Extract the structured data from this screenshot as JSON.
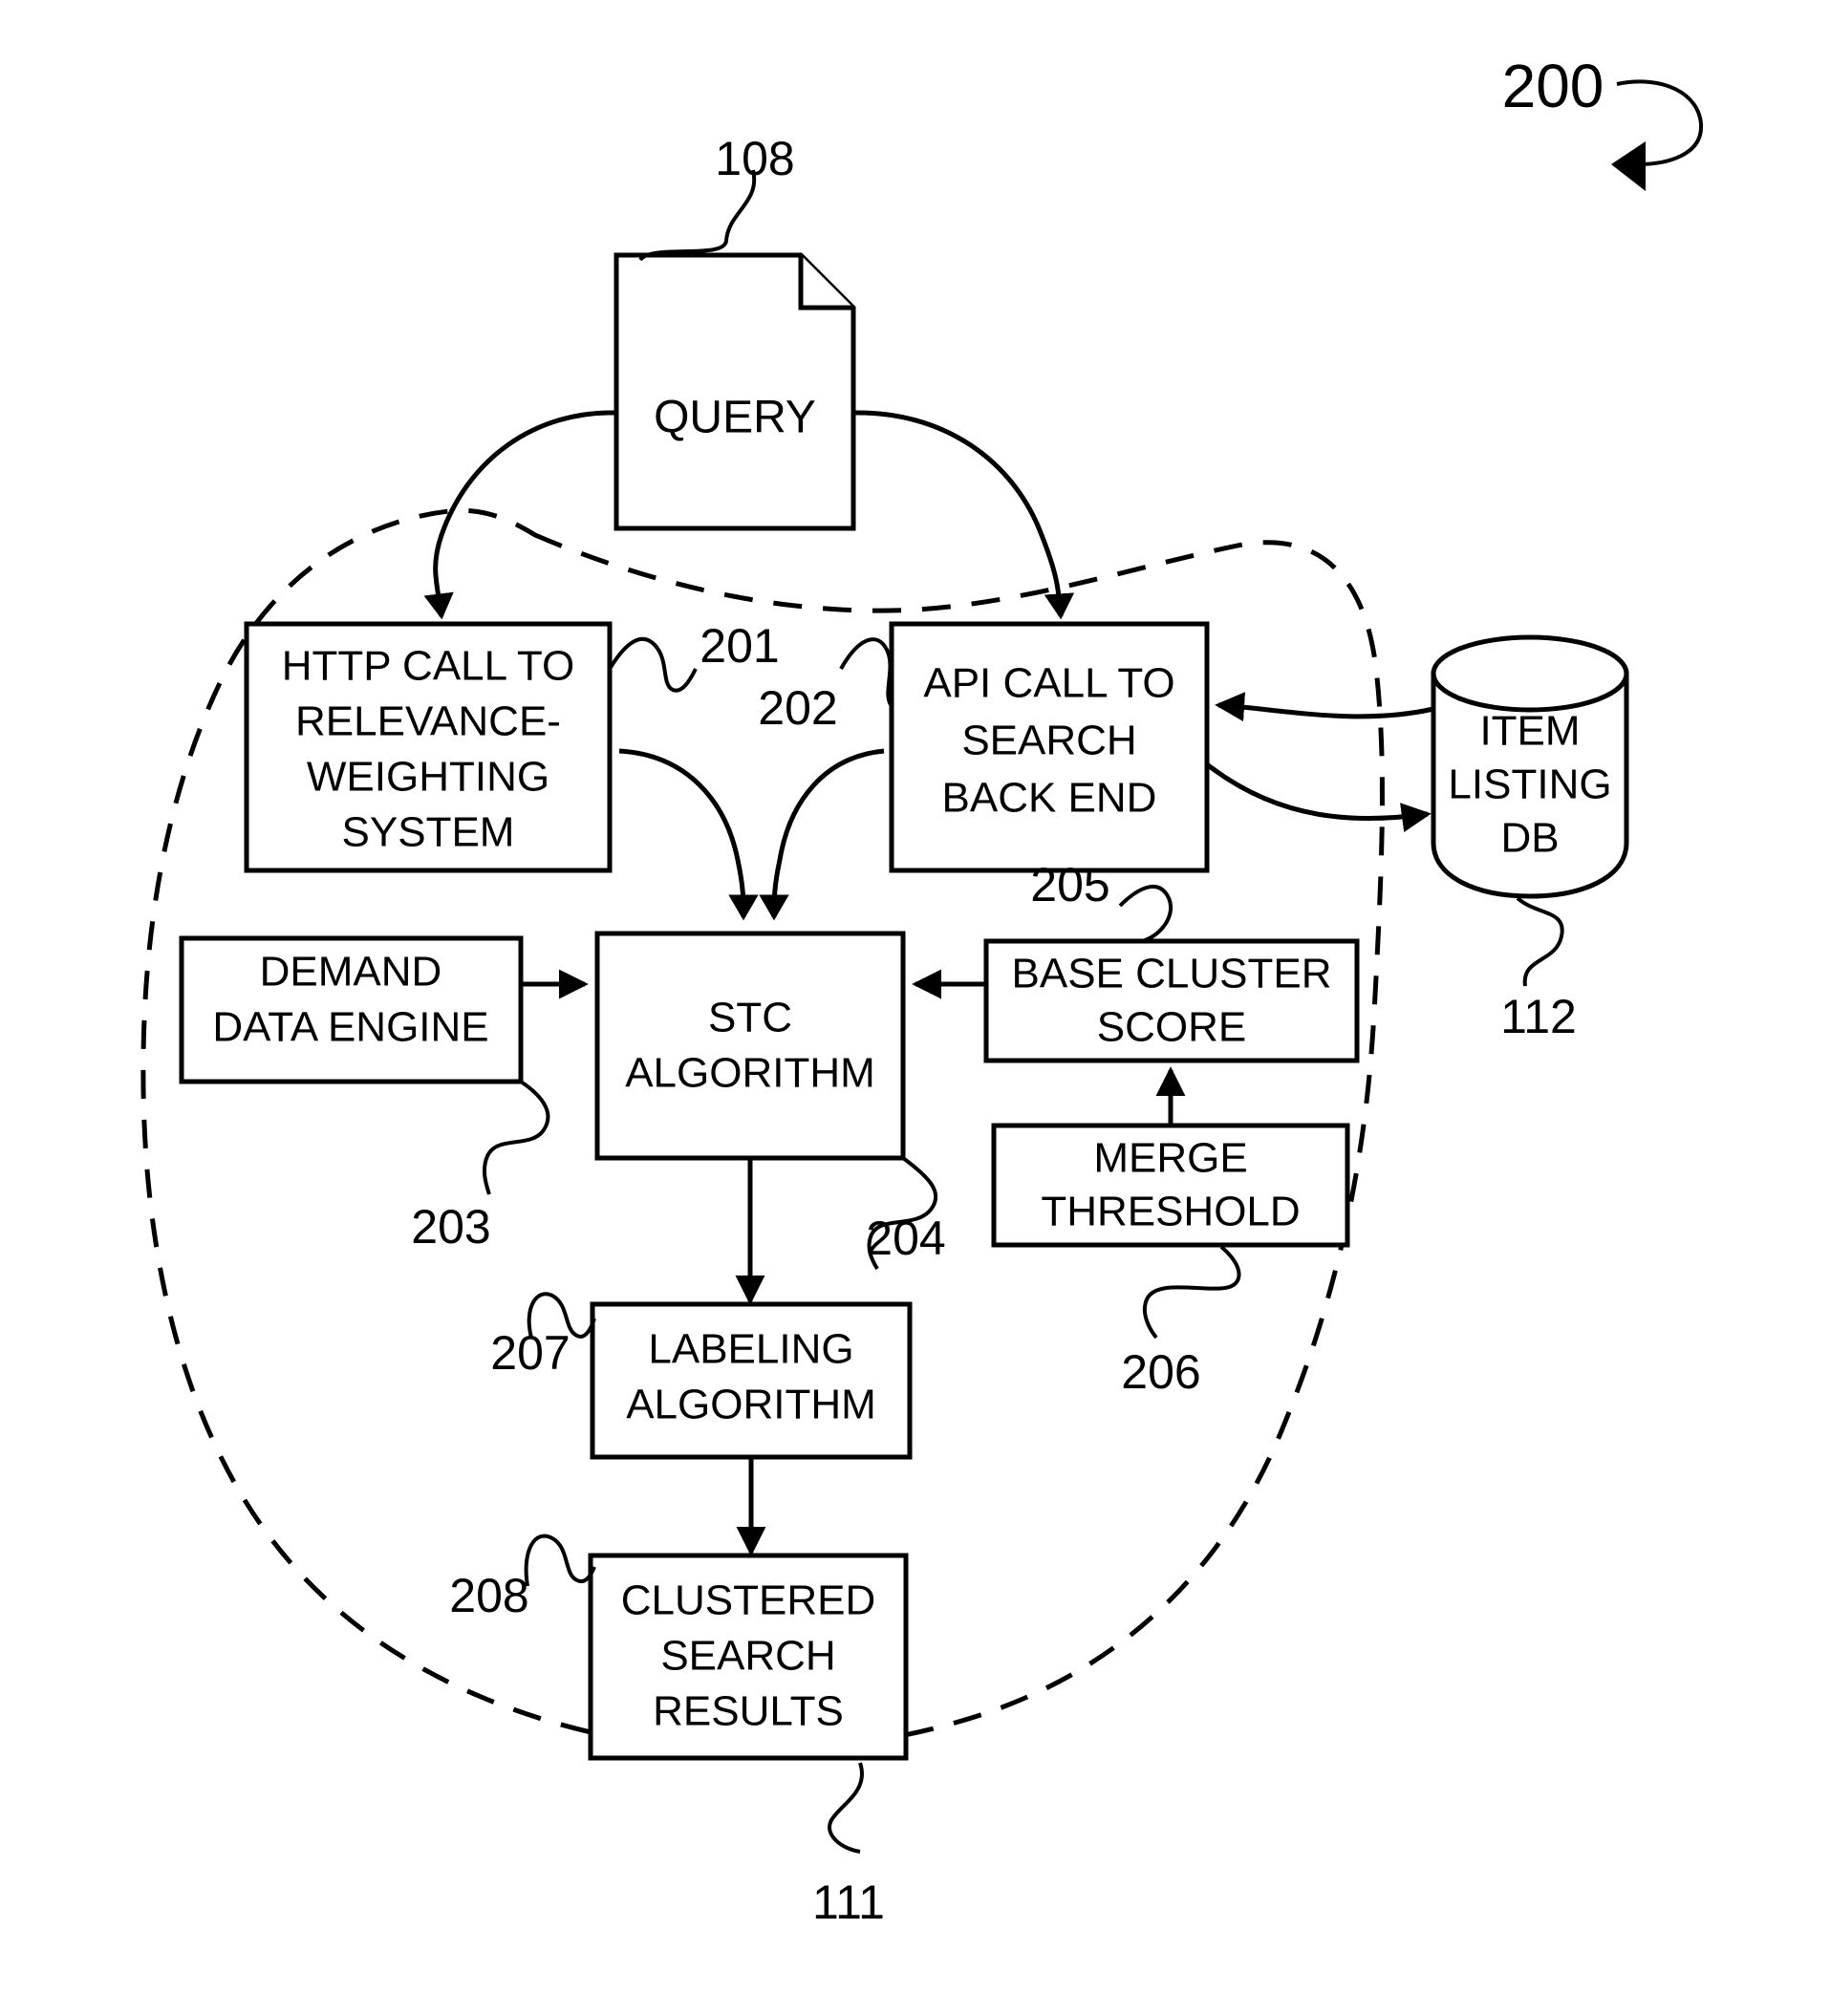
{
  "figure": {
    "number": "200"
  },
  "nodes": {
    "query": {
      "label": "QUERY",
      "ref": "108",
      "shape": "document"
    },
    "http_call": {
      "lines": [
        "HTTP CALL TO",
        "RELEVANCE-",
        "WEIGHTING",
        "SYSTEM"
      ],
      "ref": "201",
      "shape": "rect"
    },
    "api_call": {
      "lines": [
        "API CALL TO",
        "SEARCH",
        "BACK END"
      ],
      "ref": "202",
      "shape": "rect"
    },
    "item_listing_db": {
      "lines": [
        "ITEM",
        "LISTING",
        "DB"
      ],
      "ref": "112",
      "shape": "cylinder"
    },
    "demand_data_engine": {
      "lines": [
        "DEMAND",
        "DATA ENGINE"
      ],
      "ref": "203",
      "shape": "rect"
    },
    "stc_algorithm": {
      "lines": [
        "STC",
        "ALGORITHM"
      ],
      "ref": "204",
      "shape": "rect"
    },
    "base_cluster_score": {
      "lines": [
        "BASE CLUSTER",
        "SCORE"
      ],
      "ref": "205",
      "shape": "rect"
    },
    "merge_threshold": {
      "lines": [
        "MERGE",
        "THRESHOLD"
      ],
      "ref": "206",
      "shape": "rect"
    },
    "labeling_algorithm": {
      "lines": [
        "LABELING",
        "ALGORITHM"
      ],
      "ref": "207",
      "shape": "rect"
    },
    "clustered_search_results": {
      "lines": [
        "CLUSTERED",
        "SEARCH",
        "RESULTS"
      ],
      "ref": "208",
      "shape": "rect"
    },
    "system_boundary": {
      "ref": "111",
      "shape": "dashed-closed-curve"
    }
  },
  "colors": {
    "stroke": "#000000",
    "fill": "#ffffff"
  }
}
